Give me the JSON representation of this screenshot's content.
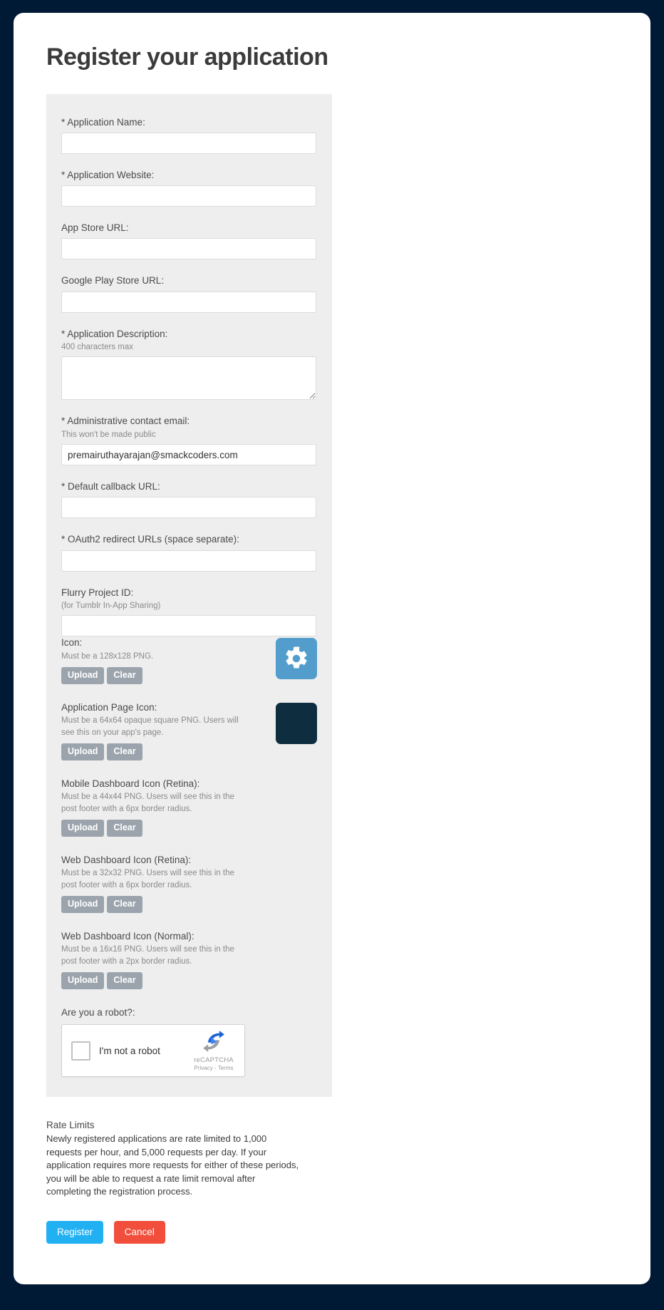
{
  "page": {
    "title": "Register your application"
  },
  "form": {
    "fields": [
      {
        "label": "* Application Name:",
        "hint": "",
        "value": "",
        "type": "text",
        "name": "application-name"
      },
      {
        "label": "* Application Website:",
        "hint": "",
        "value": "",
        "type": "text",
        "name": "application-website"
      },
      {
        "label": "App Store URL:",
        "hint": "",
        "value": "",
        "type": "text",
        "name": "app-store-url"
      },
      {
        "label": "Google Play Store URL:",
        "hint": "",
        "value": "",
        "type": "text",
        "name": "google-play-store-url"
      },
      {
        "label": "* Application Description:",
        "hint": "400 characters max",
        "value": "",
        "type": "textarea",
        "name": "application-description"
      },
      {
        "label": "* Administrative contact email:",
        "hint": "This won't be made public",
        "value": "premairuthayarajan@smackcoders.com",
        "type": "text",
        "name": "administrative-contact-email"
      },
      {
        "label": "* Default callback URL:",
        "hint": "",
        "value": "",
        "type": "text",
        "name": "default-callback-url"
      },
      {
        "label": "* OAuth2 redirect URLs (space separate):",
        "hint": "",
        "value": "",
        "type": "text",
        "name": "oauth2-redirect-urls"
      },
      {
        "label": "Flurry Project ID:",
        "hint": "(for Tumblr In-App Sharing)",
        "value": "",
        "type": "text",
        "name": "flurry-project-id"
      }
    ],
    "icon_uploads": [
      {
        "label": "Icon:",
        "description": "Must be a 128x128 PNG.",
        "upload_label": "Upload",
        "clear_label": "Clear",
        "thumbnail": "gear-icon",
        "thumbnail_color": "#529dcc",
        "name": "icon"
      },
      {
        "label": "Application Page Icon:",
        "description": "Must be a 64x64 opaque square PNG. Users will see this on your app's page.",
        "upload_label": "Upload",
        "clear_label": "Clear",
        "thumbnail": "dark-square-icon",
        "thumbnail_color": "#0e2d3f",
        "name": "application-page-icon"
      },
      {
        "label": "Mobile Dashboard Icon (Retina):",
        "description": "Must be a 44x44 PNG. Users will see this in the post footer with a 6px border radius.",
        "upload_label": "Upload",
        "clear_label": "Clear",
        "thumbnail": "",
        "thumbnail_color": "",
        "name": "mobile-dashboard-icon-retina"
      },
      {
        "label": "Web Dashboard Icon (Retina):",
        "description": "Must be a 32x32 PNG. Users will see this in the post footer with a 6px border radius.",
        "upload_label": "Upload",
        "clear_label": "Clear",
        "thumbnail": "",
        "thumbnail_color": "",
        "name": "web-dashboard-icon-retina"
      },
      {
        "label": "Web Dashboard Icon (Normal):",
        "description": "Must be a 16x16 PNG. Users will see this in the post footer with a 2px border radius.",
        "upload_label": "Upload",
        "clear_label": "Clear",
        "thumbnail": "",
        "thumbnail_color": "",
        "name": "web-dashboard-icon-normal"
      }
    ],
    "captcha": {
      "label": "Are you a robot?:",
      "checkbox_label": "I'm not a robot",
      "brand_name": "reCAPTCHA",
      "brand_links": "Privacy - Terms"
    }
  },
  "footer": {
    "rate_limits_title": "Rate Limits",
    "rate_limits_body": "Newly registered applications are rate limited to 1,000 requests per hour, and 5,000 requests per day. If your application requires more requests for either of these periods, you will be able to request a rate limit removal after completing the registration process.",
    "register_label": "Register",
    "cancel_label": "Cancel",
    "register_color": "#21b1f3",
    "cancel_color": "#f14f3c"
  }
}
